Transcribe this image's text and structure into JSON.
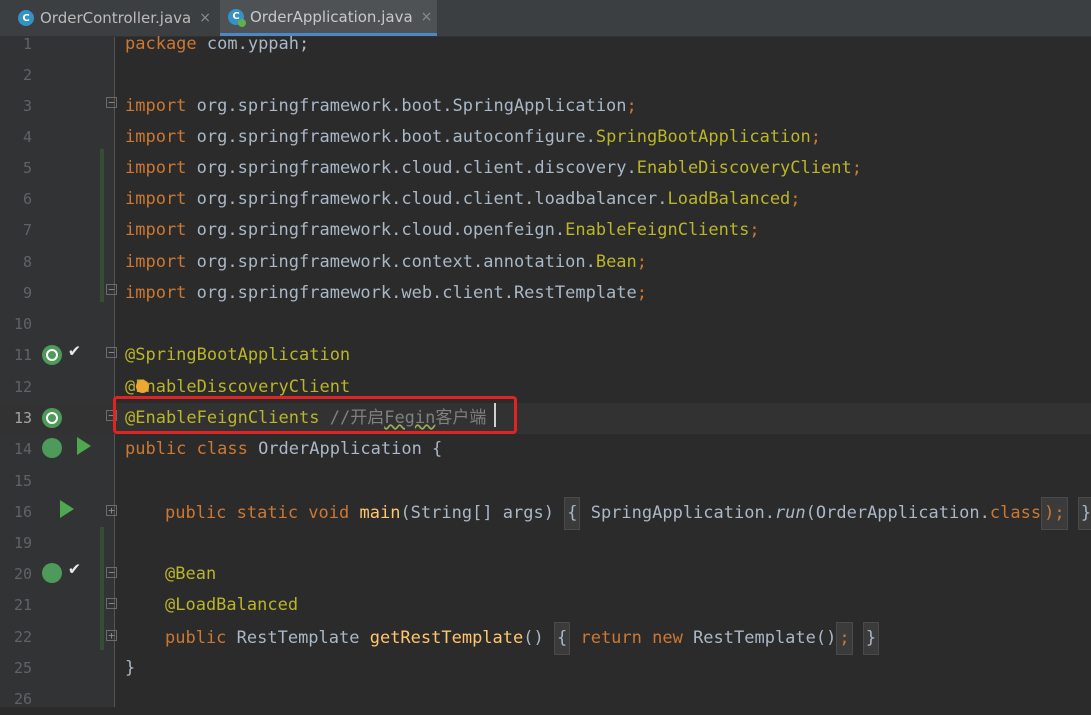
{
  "tabs": [
    {
      "label": "OrderController.java",
      "icon": "class-icon",
      "close": "×",
      "active": false
    },
    {
      "label": "OrderApplication.java",
      "icon": "spring-app-icon",
      "close": "×",
      "active": true
    }
  ],
  "line_numbers": [
    "1",
    "2",
    "3",
    "4",
    "5",
    "6",
    "7",
    "8",
    "9",
    "10",
    "11",
    "12",
    "13",
    "14",
    "15",
    "16",
    "19",
    "20",
    "21",
    "22",
    "25",
    "26"
  ],
  "code": {
    "l1": {
      "kw": "package",
      "rest": " com.yppah;"
    },
    "l3": {
      "kw": "import",
      "pkg": " org.springframework.boot.",
      "cls": "SpringApplication",
      "end": ";"
    },
    "l4": {
      "kw": "import",
      "pkg": " org.springframework.boot.autoconfigure.",
      "cls": "SpringBootApplication",
      "end": ";"
    },
    "l5": {
      "kw": "import",
      "pkg": " org.springframework.cloud.client.discovery.",
      "cls": "EnableDiscoveryClient",
      "end": ";"
    },
    "l6": {
      "kw": "import",
      "pkg": " org.springframework.cloud.client.loadbalancer.",
      "cls": "LoadBalanced",
      "end": ";"
    },
    "l7": {
      "kw": "import",
      "pkg": " org.springframework.cloud.openfeign.",
      "cls": "EnableFeignClients",
      "end": ";"
    },
    "l8": {
      "kw": "import",
      "pkg": " org.springframework.context.annotation.",
      "cls": "Bean",
      "end": ";"
    },
    "l9": {
      "kw": "import",
      "pkg": " org.springframework.web.client.",
      "cls": "RestTemplate",
      "end": ";"
    },
    "l11": {
      "ann": "@SpringBootApplication"
    },
    "l12": {
      "at": "@",
      "ann": "EnableDiscoveryClient"
    },
    "l13": {
      "ann": "@EnableFeignClients",
      "space": " ",
      "cmt1": "//开启",
      "cmt2": "Fegin",
      "cmt3": "客户端"
    },
    "l14": {
      "kw": "public class",
      "rest": " OrderApplication {"
    },
    "l16": {
      "kw": "public static void",
      "fn": "main",
      "args": "(String[] args)",
      "body1": "{",
      "body2": " SpringApplication.",
      "run": "run",
      "body3": "(OrderApplication.",
      "cls": "class",
      "body4": ");",
      "body5": "}"
    },
    "l20": {
      "ann": "@Bean"
    },
    "l21": {
      "ann": "@LoadBalanced"
    },
    "l22": {
      "kw": "public",
      "type": " RestTemplate ",
      "fn": "getRestTemplate",
      "args": "()",
      "body1": "{",
      "ret": " return new",
      "body2": " RestTemplate()",
      "body3": ";",
      "body4": "}"
    },
    "l25": {
      "rest": "}"
    }
  }
}
